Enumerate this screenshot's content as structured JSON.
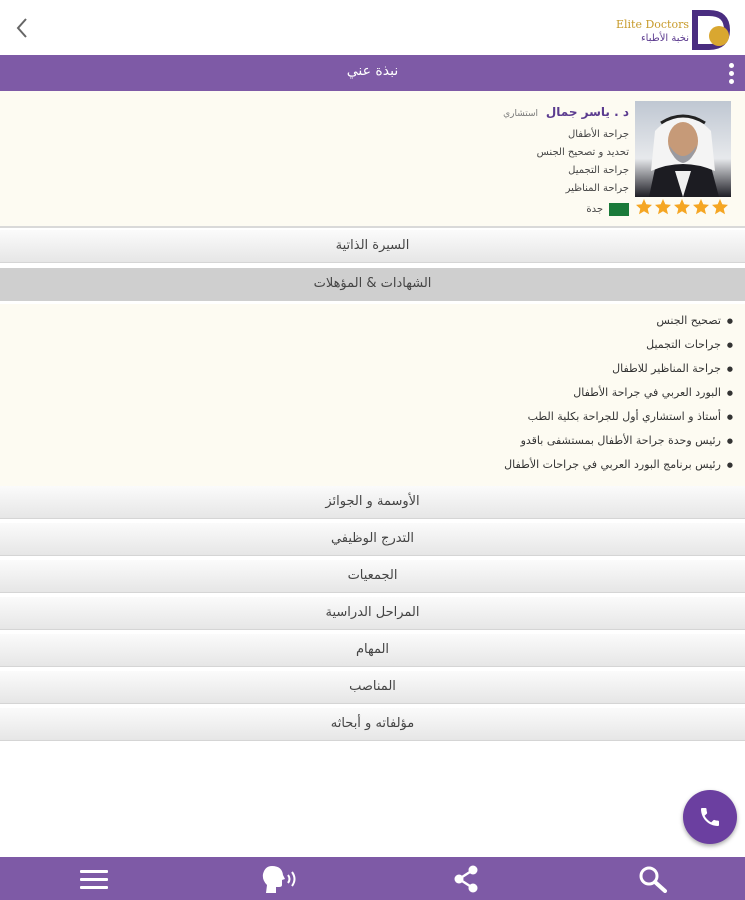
{
  "header": {
    "logo_en": "Elite Doctors",
    "logo_ar": "نخبة الأطباء",
    "title": "نبذة عني"
  },
  "profile": {
    "name": "د . ياسر جمال",
    "role": "استشاري",
    "specialties": [
      "جراحة الأطفال",
      "تحديد و تصحيح الجنس",
      "جراحة التجميل",
      "جراحة المناظير"
    ],
    "rating": 5,
    "city": "جدة"
  },
  "sections": [
    {
      "label": "السيرة الذاتية"
    },
    {
      "label": "الشهادات & المؤهلات"
    },
    {
      "label": "الأوسمة و الجوائز"
    },
    {
      "label": "التدرج الوظيفي"
    },
    {
      "label": "الجمعيات"
    },
    {
      "label": "المراحل الدراسية"
    },
    {
      "label": "المهام"
    },
    {
      "label": "المناصب"
    },
    {
      "label": "مؤلفاته و أبحاثه"
    }
  ],
  "certificates": [
    "تصحيح الجنس",
    "جراحات التجميل",
    "جراحة المناظير للاطفال",
    "البورد العربي في جراحة الأطفال",
    "أستاذ و استشاري أول للجراحة بكلية الطب",
    "رئيس وحدة جراحة الأطفال بمستشفى باقدو",
    "رئيس برنامج البورد العربي في جراحات الأطفال"
  ],
  "colors": {
    "primary": "#7e5aa6",
    "accent": "#6b3fa0",
    "star": "#f5a623",
    "panel_bg": "#fdfbf2"
  },
  "icons": {
    "back": "chevron-left-icon",
    "more": "kebab-menu-icon",
    "call": "phone-icon",
    "menu": "hamburger-icon",
    "voice": "voice-icon",
    "share": "share-icon",
    "search": "search-icon"
  }
}
